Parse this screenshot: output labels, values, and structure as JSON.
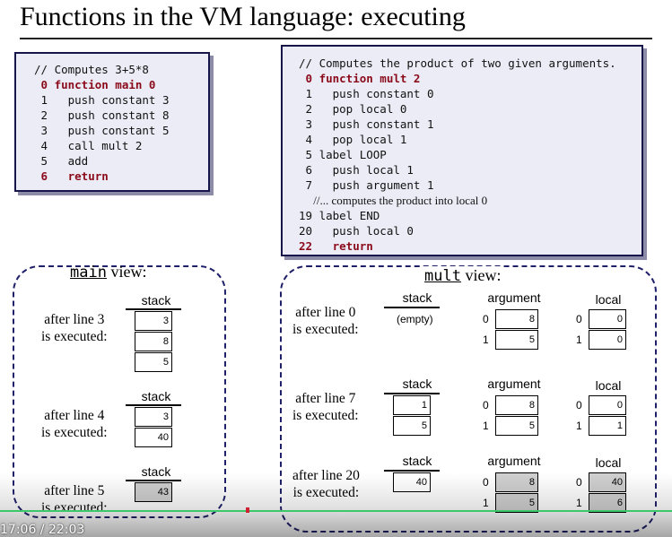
{
  "title": "Functions in the VM language: executing",
  "main_code": {
    "lines": [
      "// Computes 3+5*8",
      " 0 function main 0",
      " 1   push constant 3",
      " 2   push constant 8",
      " 3   push constant 5",
      " 4   call mult 2",
      " 5   add",
      " 6   return"
    ]
  },
  "mult_code": {
    "lines": [
      "// Computes the product of two given arguments.",
      " 0 function mult 2",
      " 1   push constant 0",
      " 2   pop local 0",
      " 3   push constant 1",
      " 4   pop local 1",
      " 5 label LOOP",
      " 6   push local 1",
      " 7   push argument 1",
      "     //... computes the product into local 0",
      "19 label END",
      "20   push local 0",
      "22   return"
    ]
  },
  "main_view": {
    "title_mono": "main",
    "title_rest": " view:",
    "stack_header": "stack",
    "states": [
      {
        "label": "after line 3\nis executed:",
        "stack": [
          "3",
          "8",
          "5"
        ]
      },
      {
        "label": "after line 4\nis executed:",
        "stack": [
          "3",
          "40"
        ]
      },
      {
        "label": "after line 5\nis executed:",
        "stack": [
          "43"
        ]
      }
    ]
  },
  "mult_view": {
    "title_mono": "mult",
    "title_rest": " view:",
    "stack_header": "stack",
    "argument_header": "argument",
    "local_header": "local",
    "empty_label": "(empty)",
    "index_labels": [
      "0",
      "1"
    ],
    "states": [
      {
        "label": "after line 0\nis executed:",
        "stack": [],
        "argument": [
          "8",
          "5"
        ],
        "local": [
          "0",
          "0"
        ]
      },
      {
        "label": "after line 7\nis executed:",
        "stack": [
          "1",
          "5"
        ],
        "argument": [
          "8",
          "5"
        ],
        "local": [
          "0",
          "1"
        ]
      },
      {
        "label": "after line 20\nis executed:",
        "stack": [
          "40"
        ],
        "argument": [
          "8",
          "5"
        ],
        "local": [
          "40",
          "6"
        ]
      }
    ]
  },
  "video": {
    "timestamp": "17:06 / 22:03",
    "progress_fraction": 0.776,
    "accent_color": "#3cc76a"
  }
}
